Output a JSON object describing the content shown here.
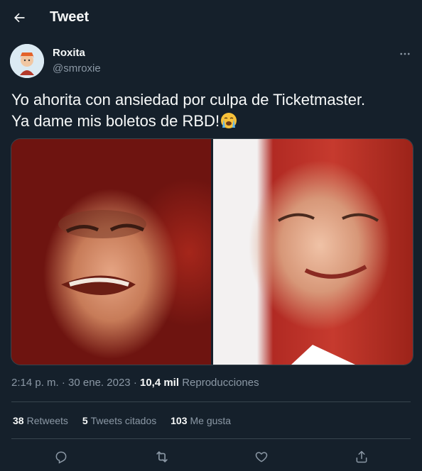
{
  "header": {
    "title": "Tweet",
    "back_icon": "arrow-left-icon"
  },
  "author": {
    "name": "Roxita",
    "handle": "@smroxie",
    "more_icon": "more-horizontal-icon"
  },
  "tweet": {
    "line1": "Yo ahorita con ansiedad por culpa de Ticketmaster.",
    "line2": "Ya dame mis boletos de RBD!",
    "emoji": "loudly-crying-face-emoji"
  },
  "media": {
    "panels": [
      "left-photo",
      "right-photo"
    ]
  },
  "meta": {
    "time": "2:14 p. m.",
    "dot": "·",
    "date": "30 ene. 2023",
    "views_count": "10,4 mil",
    "views_label": "Reproducciones"
  },
  "stats": {
    "retweets_count": "38",
    "retweets_label": "Retweets",
    "quotes_count": "5",
    "quotes_label": "Tweets citados",
    "likes_count": "103",
    "likes_label": "Me gusta"
  },
  "actions": [
    "reply-icon",
    "retweet-icon",
    "like-icon",
    "share-icon"
  ],
  "colors": {
    "background": "#15202b",
    "text": "#f7f9f9",
    "secondary": "#8b98a5",
    "border": "#38444d"
  }
}
